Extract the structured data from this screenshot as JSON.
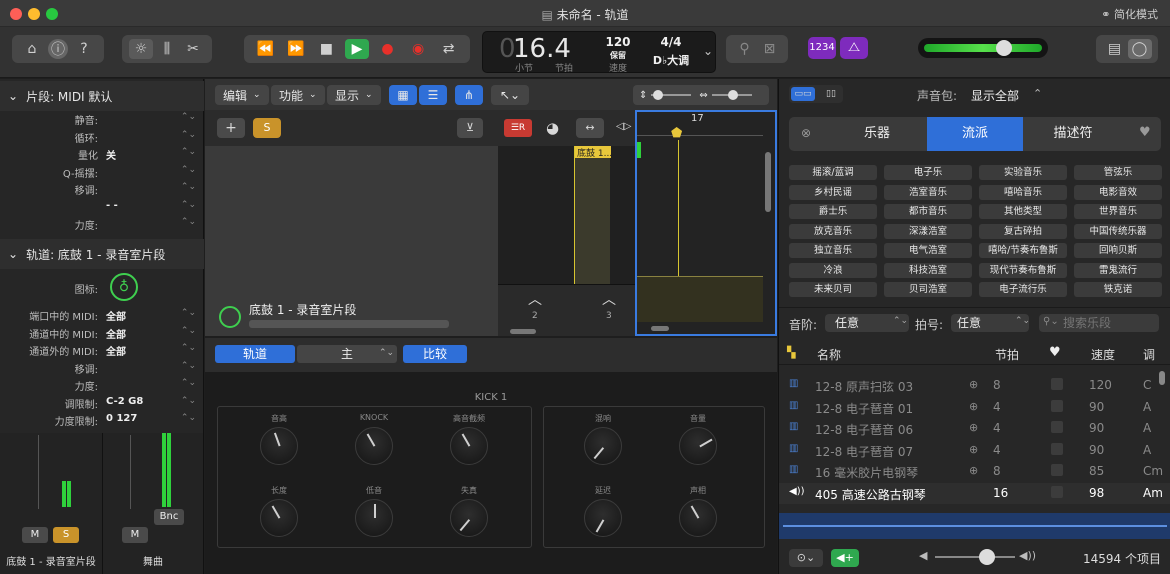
{
  "window": {
    "title": "未命名 - 轨道",
    "simplify_mode": "简化模式"
  },
  "lcd": {
    "position": "16.4",
    "bar_label": "小节",
    "beat_label": "节拍",
    "tempo": "120",
    "tempo_mode": "保留",
    "tempo_label": "速度",
    "signature": "4/4",
    "key": "D♭大调"
  },
  "toolbar": {
    "count_in": "1234"
  },
  "inspector": {
    "region_header": "片段: MIDI 默认",
    "region_rows": [
      {
        "label": "静音:",
        "value": ""
      },
      {
        "label": "循环:",
        "value": ""
      },
      {
        "label": "量化",
        "value": "关"
      },
      {
        "label": "Q-摇摆:",
        "value": ""
      },
      {
        "label": "移调:",
        "value": ""
      },
      {
        "label": "",
        "value": "- -"
      },
      {
        "label": "力度:",
        "value": ""
      }
    ],
    "track_header": "轨道: 底鼓 1 - 录音室片段",
    "icon_label": "图标:",
    "track_rows": [
      {
        "label": "端口中的 MIDI:",
        "value": "全部"
      },
      {
        "label": "通道中的 MIDI:",
        "value": "全部"
      },
      {
        "label": "通道外的 MIDI:",
        "value": "全部"
      },
      {
        "label": "移调:",
        "value": ""
      },
      {
        "label": "力度:",
        "value": ""
      },
      {
        "label": "调限制:",
        "value": "C-2  G8"
      },
      {
        "label": "力度限制:",
        "value": "0  127"
      }
    ]
  },
  "strips": {
    "m": "M",
    "s": "S",
    "bnc": "Bnc",
    "left_name": "底鼓 1 - 录音室片段",
    "right_name": "舞曲"
  },
  "tracks_bar": {
    "edit": "编辑",
    "functions": "功能",
    "view": "显示"
  },
  "track_header": {
    "add": "+",
    "solo": "S"
  },
  "track": {
    "name": "底鼓 1 - 录音室片段",
    "region": "底鼓 1..."
  },
  "ruler": {
    "bar2": "2",
    "bar3": "3",
    "bar17": "17"
  },
  "smart_controls": {
    "tab_track": "轨道",
    "tab_master": "主",
    "compare": "比较",
    "title": "KICK 1",
    "knobs_a": [
      [
        "音高",
        "KNOCK",
        "高音截频"
      ],
      [
        "长度",
        "低音",
        "失真"
      ]
    ],
    "knobs_b": [
      [
        "混响",
        "音量"
      ],
      [
        "延迟",
        "声相"
      ]
    ]
  },
  "browser": {
    "sound_pack_label": "声音包:",
    "sound_pack_value": "显示全部",
    "tabs": [
      "乐器",
      "流派",
      "描述符"
    ],
    "genres": [
      "摇滚/蓝调",
      "电子乐",
      "实验音乐",
      "管弦乐",
      "乡村民谣",
      "浩室音乐",
      "嘻哈音乐",
      "电影音效",
      "爵士乐",
      "都市音乐",
      "其他类型",
      "世界音乐",
      "放克音乐",
      "深漾浩室",
      "复古碎拍",
      "中国传统乐器",
      "独立音乐",
      "电气浩室",
      "嘻哈/节奏布鲁斯",
      "回响贝斯",
      "冷浪",
      "科技浩室",
      "现代节奏布鲁斯",
      "雷鬼流行",
      "未来贝司",
      "贝司浩室",
      "电子流行乐",
      "铁克诺"
    ],
    "scale_label": "音阶:",
    "scale_value": "任意",
    "sig_label": "拍号:",
    "sig_value": "任意",
    "search_placeholder": "搜索乐段",
    "columns": [
      "名称",
      "节拍",
      "速度",
      "调"
    ],
    "rows": [
      {
        "name": "12-8 原声扫弦 03",
        "beats": "8",
        "tempo": "120",
        "key": "C"
      },
      {
        "name": "12-8 电子琶音 01",
        "beats": "4",
        "tempo": "90",
        "key": "A"
      },
      {
        "name": "12-8 电子琶音 06",
        "beats": "4",
        "tempo": "90",
        "key": "A"
      },
      {
        "name": "12-8 电子琶音 07",
        "beats": "4",
        "tempo": "90",
        "key": "A"
      },
      {
        "name": "16 毫米胶片电钢琴",
        "beats": "8",
        "tempo": "85",
        "key": "Cm"
      },
      {
        "name": "405 高速公路古钢琴",
        "beats": "16",
        "tempo": "98",
        "key": "Am"
      }
    ],
    "count": "14594 个项目"
  }
}
